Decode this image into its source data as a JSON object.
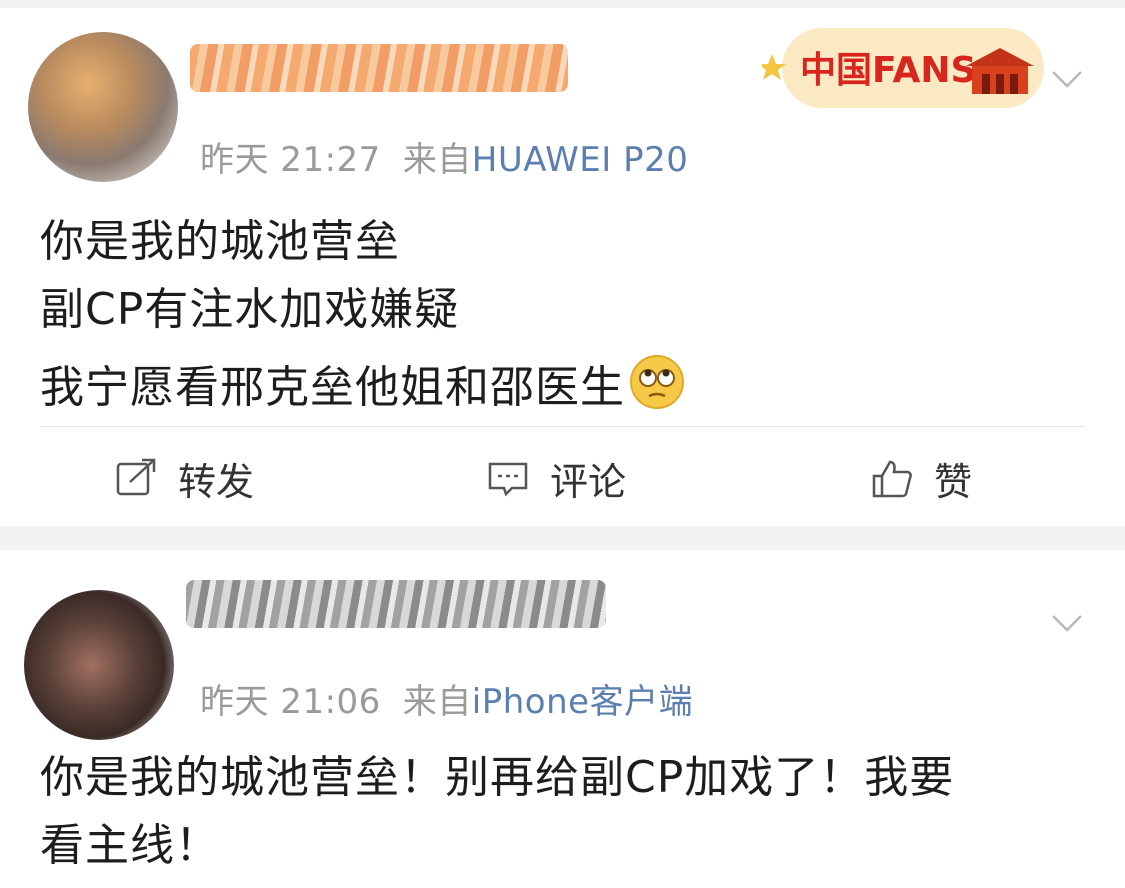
{
  "posts": [
    {
      "time": "昨天 21:27",
      "source_prefix": "来自",
      "source": "HUAWEI P20",
      "badge_text": "中国FANS",
      "lines": [
        "你是我的城池营垒",
        "副CP有注水加戏嫌疑",
        "我宁愿看邢克垒他姐和邵医生"
      ],
      "emoji": "rolling-eyes-emoji",
      "actions": {
        "repost": "转发",
        "comment": "评论",
        "like": "赞"
      }
    },
    {
      "time": "昨天 21:06",
      "source_prefix": "来自",
      "source": "iPhone客户端",
      "lines": [
        "你是我的城池营垒！别再给副CP加戏了！我要",
        "看主线！"
      ]
    }
  ],
  "colors": {
    "source_link": "#5a7fb0",
    "meta": "#9a9a9a",
    "background": "#f2f2f2"
  },
  "icons": [
    "repost-icon",
    "comment-icon",
    "like-icon",
    "chevron-down-icon"
  ]
}
